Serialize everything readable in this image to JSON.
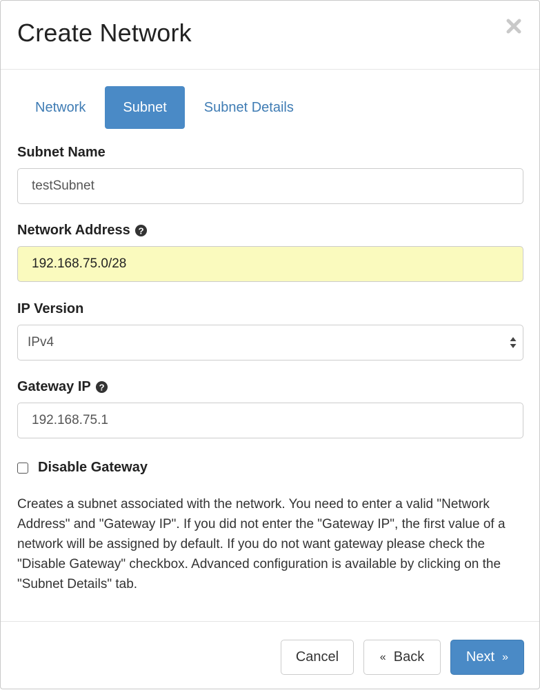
{
  "dialog": {
    "title": "Create Network"
  },
  "tabs": [
    {
      "label": "Network",
      "active": false
    },
    {
      "label": "Subnet",
      "active": true
    },
    {
      "label": "Subnet Details",
      "active": false
    }
  ],
  "form": {
    "subnet_name": {
      "label": "Subnet Name",
      "value": "testSubnet"
    },
    "network_address": {
      "label": "Network Address",
      "value": "192.168.75.0/28",
      "help_icon": "question-circle-icon"
    },
    "ip_version": {
      "label": "IP Version",
      "selected": "IPv4"
    },
    "gateway_ip": {
      "label": "Gateway IP",
      "value": "192.168.75.1",
      "help_icon": "question-circle-icon"
    },
    "disable_gateway": {
      "label": "Disable Gateway",
      "checked": false
    }
  },
  "help_text": "Creates a subnet associated with the network. You need to enter a valid \"Network Address\" and \"Gateway IP\". If you did not enter the \"Gateway IP\", the first value of a network will be assigned by default. If you do not want gateway please check the \"Disable Gateway\" checkbox. Advanced configuration is available by clicking on the \"Subnet Details\" tab.",
  "footer": {
    "cancel_label": "Cancel",
    "back_label": "Back",
    "back_prefix": "«",
    "next_label": "Next",
    "next_suffix": "»"
  },
  "colors": {
    "accent": "#4a8ac6",
    "tab_link": "#3f7cb4",
    "highlight_field": "#fafabe"
  }
}
